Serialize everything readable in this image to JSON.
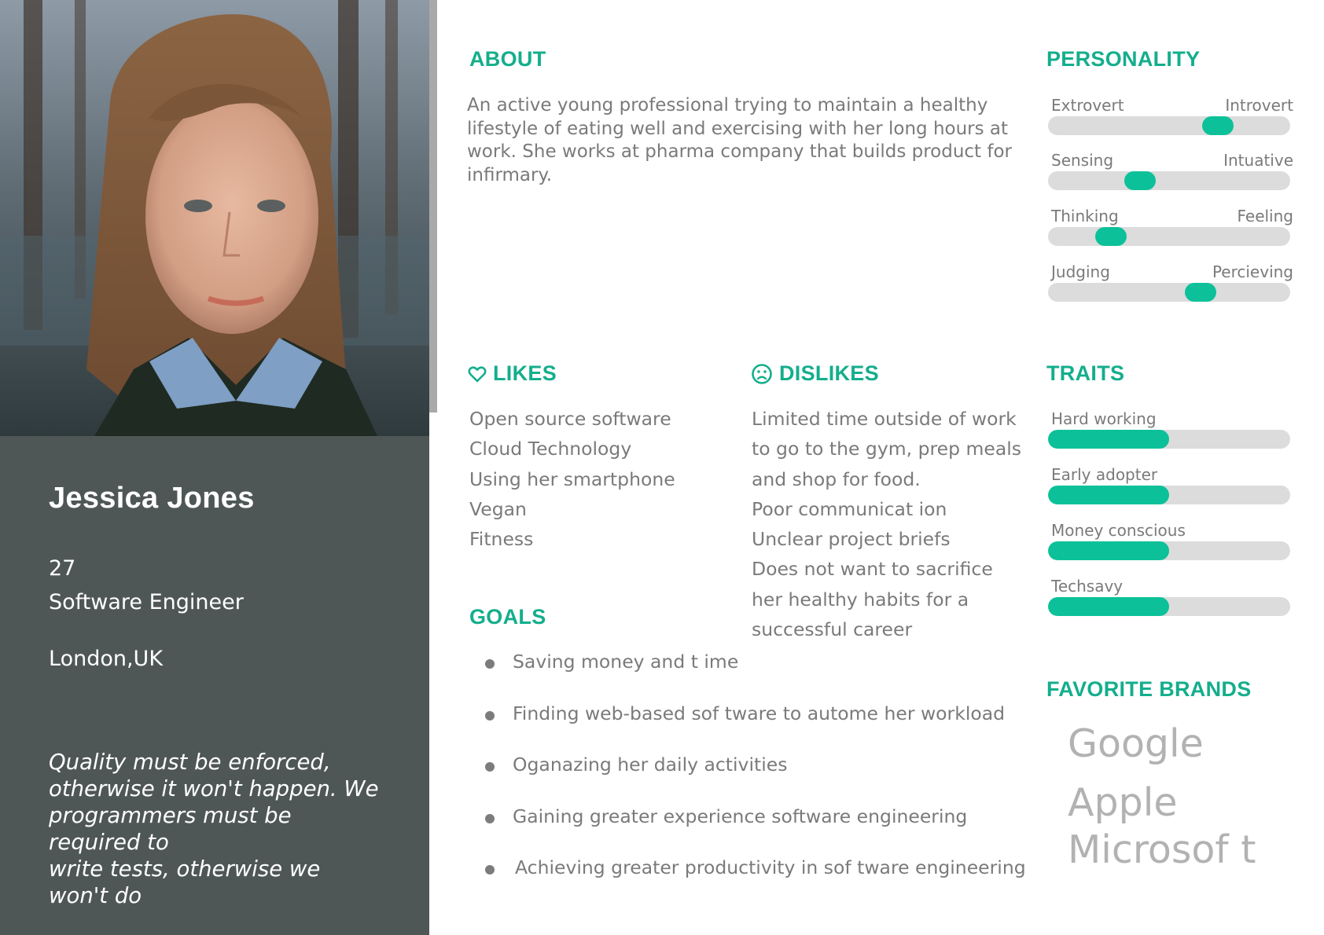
{
  "persona": {
    "name": "Jessica Jones",
    "age": "27",
    "occupation": "Software Engineer",
    "location": "London,UK",
    "quote": [
      "Quality must be enforced,",
      "otherwise it won't happen. We",
      "programmers must be",
      "required to",
      "write tests, otherwise we",
      "won't do"
    ]
  },
  "about": {
    "heading": "ABOUT",
    "lines": [
      "An active young professional trying to maintain a healthy",
      "lifestyle of eating well and exercising with her long hours at",
      "work. She works at pharma company that builds product for",
      "infirmary."
    ]
  },
  "likes": {
    "heading": "LIKES",
    "icon": "heart-icon",
    "items": [
      "Open source software",
      "Cloud Technology",
      "Using her smartphone",
      "Vegan",
      "Fitness"
    ]
  },
  "dislikes": {
    "heading": "DISLIKES",
    "icon": "sad-face-icon",
    "items": [
      "Limited time outside of work",
      "to go to the gym, prep meals",
      "and shop for food.",
      "Poor communicat ion",
      "Unclear project briefs",
      "Does not want to sacrifice",
      "her healthy habits for a",
      "successful career"
    ]
  },
  "goals": {
    "heading": "GOALS",
    "items": [
      "Saving money and t ime",
      "Finding web-based sof tware to autome her workload",
      "Oganazing her daily activities",
      "Gaining greater experience software engineering",
      "Achieving greater productivity in sof tware engineering"
    ]
  },
  "personality": {
    "heading": "PERSONALITY",
    "scales": [
      {
        "left": "Extrovert",
        "right": "Introvert",
        "value": 0.7
      },
      {
        "left": "Sensing",
        "right": "Intuative",
        "value": 0.38
      },
      {
        "left": "Thinking",
        "right": "Feeling",
        "value": 0.26
      },
      {
        "left": "Judging",
        "right": "Percieving",
        "value": 0.63
      }
    ]
  },
  "traits": {
    "heading": "TRAITS",
    "items": [
      {
        "label": "Hard working",
        "value": 0.5
      },
      {
        "label": "Early adopter",
        "value": 0.5
      },
      {
        "label": "Money conscious",
        "value": 0.5
      },
      {
        "label": "Techsavy",
        "value": 0.5
      }
    ]
  },
  "brands": {
    "heading": "FAVORITE BRANDS",
    "items": [
      "Google",
      "Apple",
      "Microsof t"
    ]
  },
  "colors": {
    "accent": "#14ae8c",
    "bar_fill": "#0cc199",
    "bar_track": "#dcdcdc",
    "profile_bg": "#4f5756"
  }
}
